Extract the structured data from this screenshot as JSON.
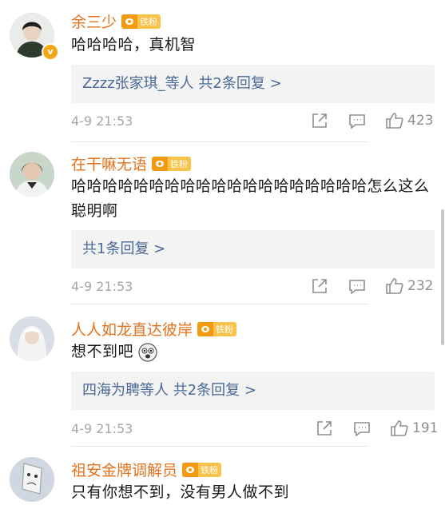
{
  "comments": [
    {
      "username": "余三少",
      "fan_badge": "铁粉",
      "verified": "v",
      "text": "哈哈哈哈，真机智",
      "replies": "Zzzz张家琪_等人 共2条回复 >",
      "time": "4-9 21:53",
      "likes": "423"
    },
    {
      "username": "在干嘛无语",
      "fan_badge": "铁粉",
      "text": "哈哈哈哈哈哈哈哈哈哈哈哈哈哈哈哈哈哈哈怎么这么聪明啊",
      "replies": "共1条回复 >",
      "time": "4-9 21:53",
      "likes": "232"
    },
    {
      "username": "人人如龙直达彼岸",
      "fan_badge": "铁粉",
      "text": "想不到吧",
      "replies": "四海为聘等人 共2条回复 >",
      "time": "4-9 21:53",
      "likes": "191"
    },
    {
      "username": "祖安金牌调解员",
      "fan_badge": "铁粉",
      "text": "只有你想不到，没有男人做不到"
    }
  ],
  "icons": [
    "share-icon",
    "comment-icon",
    "like-icon",
    "emoji-icon"
  ],
  "colors": {
    "username": "#e2731e",
    "reply_link": "#4a6a97",
    "badge": "#f9c24a"
  }
}
